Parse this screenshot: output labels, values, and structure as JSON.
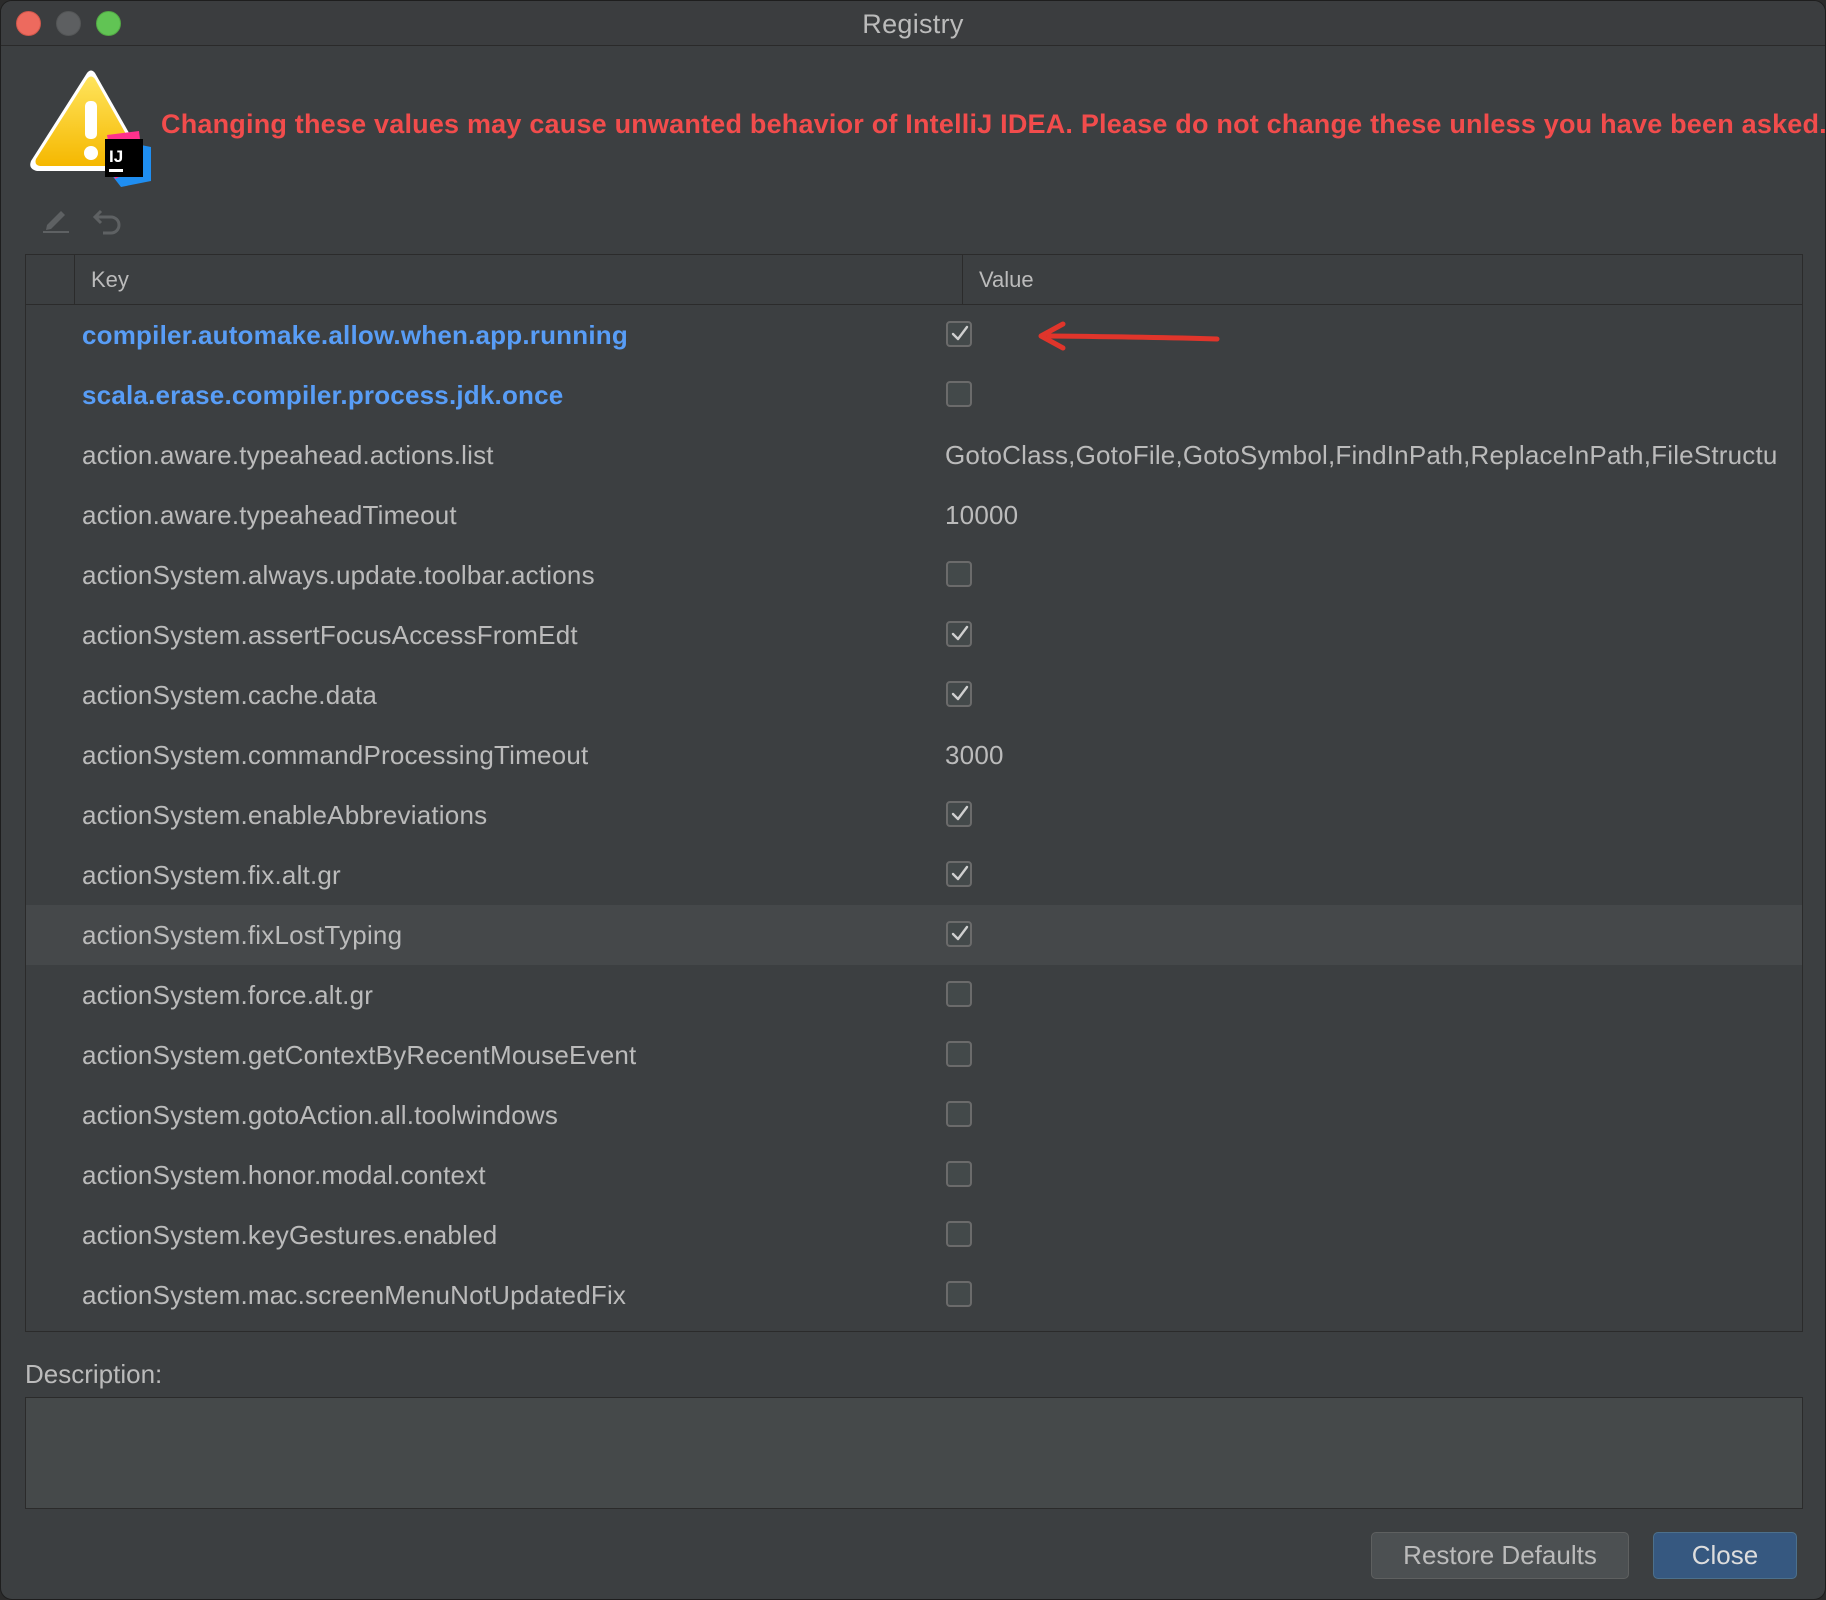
{
  "window": {
    "title": "Registry"
  },
  "warning": {
    "text": "Changing these values may cause unwanted behavior of IntelliJ IDEA. Please do not change these unless you have been asked.",
    "badge_text": "IJ"
  },
  "toolbar": {
    "edit_icon": "pencil-icon",
    "revert_icon": "undo-icon"
  },
  "table": {
    "columns": {
      "key": "Key",
      "value": "Value"
    },
    "rows": [
      {
        "key": "compiler.automake.allow.when.app.running",
        "type": "bool",
        "checked": true,
        "modified": true
      },
      {
        "key": "scala.erase.compiler.process.jdk.once",
        "type": "bool",
        "checked": false,
        "modified": true
      },
      {
        "key": "action.aware.typeahead.actions.list",
        "type": "text",
        "value": "GotoClass,GotoFile,GotoSymbol,FindInPath,ReplaceInPath,FileStructu"
      },
      {
        "key": "action.aware.typeaheadTimeout",
        "type": "text",
        "value": "10000"
      },
      {
        "key": "actionSystem.always.update.toolbar.actions",
        "type": "bool",
        "checked": false
      },
      {
        "key": "actionSystem.assertFocusAccessFromEdt",
        "type": "bool",
        "checked": true
      },
      {
        "key": "actionSystem.cache.data",
        "type": "bool",
        "checked": true
      },
      {
        "key": "actionSystem.commandProcessingTimeout",
        "type": "text",
        "value": "3000"
      },
      {
        "key": "actionSystem.enableAbbreviations",
        "type": "bool",
        "checked": true
      },
      {
        "key": "actionSystem.fix.alt.gr",
        "type": "bool",
        "checked": true
      },
      {
        "key": "actionSystem.fixLostTyping",
        "type": "bool",
        "checked": true,
        "selected": true
      },
      {
        "key": "actionSystem.force.alt.gr",
        "type": "bool",
        "checked": false
      },
      {
        "key": "actionSystem.getContextByRecentMouseEvent",
        "type": "bool",
        "checked": false
      },
      {
        "key": "actionSystem.gotoAction.all.toolwindows",
        "type": "bool",
        "checked": false
      },
      {
        "key": "actionSystem.honor.modal.context",
        "type": "bool",
        "checked": false
      },
      {
        "key": "actionSystem.keyGestures.enabled",
        "type": "bool",
        "checked": false
      },
      {
        "key": "actionSystem.mac.screenMenuNotUpdatedFix",
        "type": "bool",
        "checked": false
      }
    ]
  },
  "description": {
    "label": "Description:",
    "value": ""
  },
  "buttons": {
    "restore_defaults": "Restore Defaults",
    "close": "Close"
  },
  "colors": {
    "warning_text": "#f24c4c",
    "modified_key": "#589df6",
    "primary_button": "#365880",
    "annotation_arrow": "#e0352b"
  }
}
